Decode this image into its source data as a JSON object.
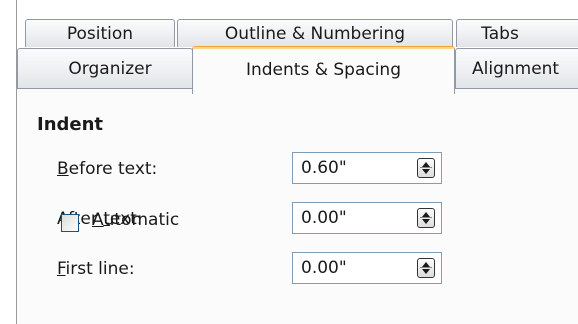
{
  "tabs_row1": {
    "position": "Position",
    "outline_numbering": "Outline & Numbering",
    "tabs": "Tabs"
  },
  "tabs_row2": {
    "organizer": "Organizer",
    "indents_spacing": "Indents & Spacing",
    "alignment": "Alignment"
  },
  "accent_color": "#f0a63c",
  "indent": {
    "title": "Indent",
    "before_text": {
      "label_mnemonic": "B",
      "label_rest": "efore text:",
      "value": "0.60\""
    },
    "after_text": {
      "label_pre": "After ",
      "label_mnemonic": "t",
      "label_post": "ext:",
      "value": "0.00\""
    },
    "first_line": {
      "label_mnemonic": "F",
      "label_rest": "irst line:",
      "value": "0.00\""
    },
    "automatic": {
      "label_mnemonic": "A",
      "label_rest": "utomatic",
      "checked": false
    }
  }
}
